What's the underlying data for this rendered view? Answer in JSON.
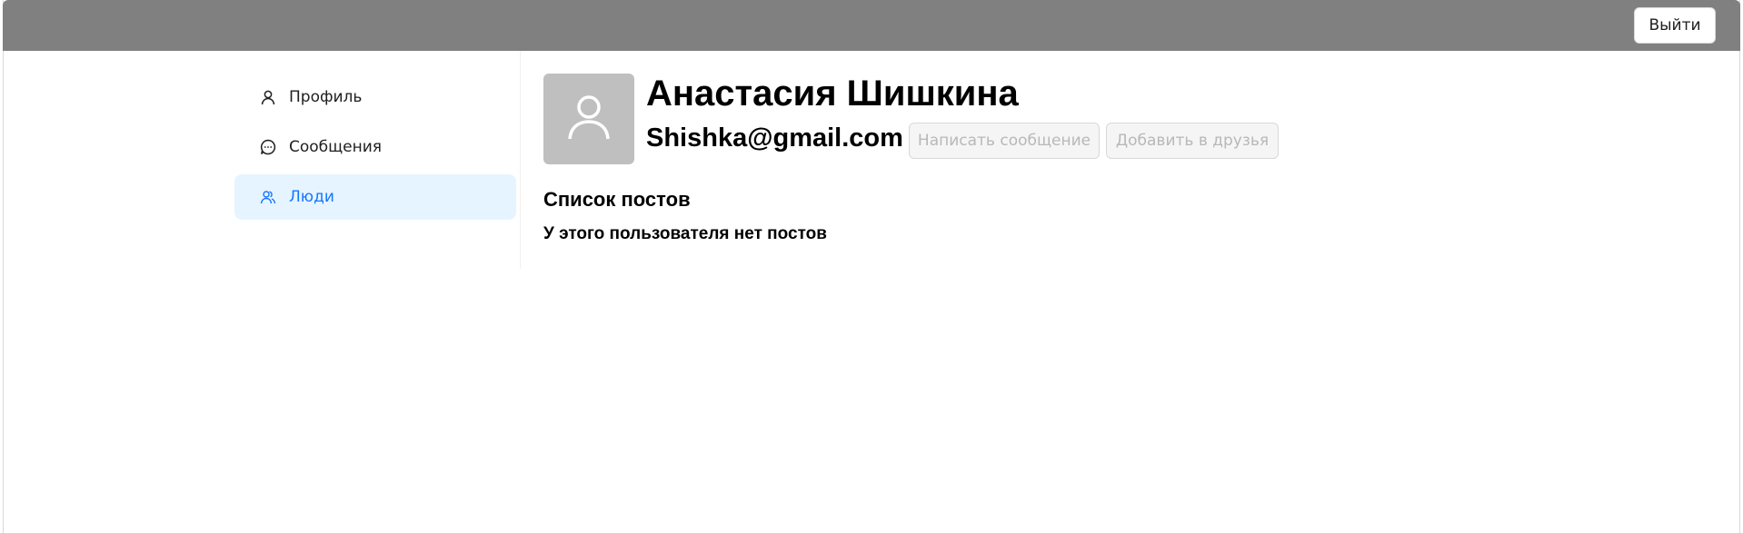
{
  "header": {
    "logout_label": "Выйти",
    "bar_color": "#808080"
  },
  "sidebar": {
    "items": [
      {
        "label": "Профиль",
        "icon": "user-icon",
        "active": false
      },
      {
        "label": "Сообщения",
        "icon": "message-icon",
        "active": false
      },
      {
        "label": "Люди",
        "icon": "team-icon",
        "active": true
      }
    ],
    "active_color": "#1677ff",
    "active_bg": "#e6f4ff"
  },
  "profile": {
    "avatar_icon": "user-icon",
    "name": "Анастасия Шишкина",
    "email": "Shishka@gmail.com",
    "write_message_label": "Написать сообщение",
    "add_friend_label": "Добавить в друзья"
  },
  "posts": {
    "title": "Список постов",
    "empty_text": "У этого пользователя нет постов"
  }
}
